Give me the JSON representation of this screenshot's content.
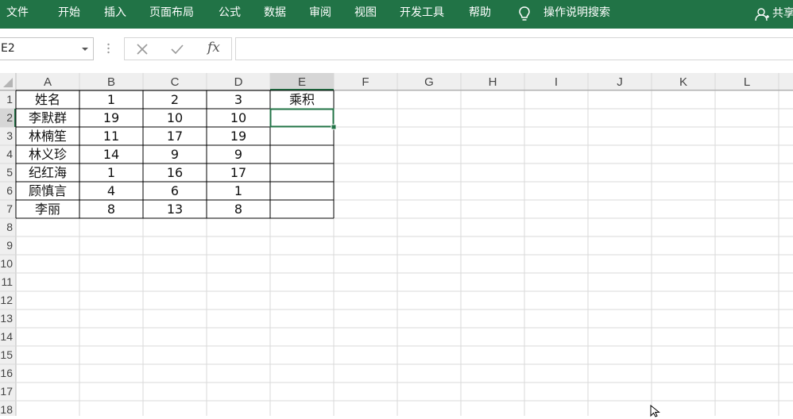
{
  "ribbon": {
    "tabs": [
      "文件",
      "开始",
      "插入",
      "页面布局",
      "公式",
      "数据",
      "审阅",
      "视图",
      "开发工具",
      "帮助"
    ],
    "tell_me": "操作说明搜索",
    "share": "共享",
    "colors": {
      "ribbon_bg": "#217346",
      "ribbon_text": "#ffffff"
    }
  },
  "formula_bar": {
    "name_box": "E2",
    "cancel_icon": "x-icon",
    "enter_icon": "check-icon",
    "function_label": "fx",
    "formula": ""
  },
  "sheet": {
    "columns": [
      "A",
      "B",
      "C",
      "D",
      "E",
      "F",
      "G",
      "H",
      "I",
      "J",
      "K",
      "L"
    ],
    "rows": [
      "1",
      "2",
      "3",
      "4",
      "5",
      "6",
      "7",
      "8",
      "9",
      "10",
      "11",
      "12",
      "13",
      "14",
      "15",
      "16",
      "17",
      "18"
    ],
    "selected_cell": "E2",
    "table": [
      [
        "姓名",
        "1",
        "2",
        "3",
        "乘积"
      ],
      [
        "李默群",
        "19",
        "10",
        "10",
        ""
      ],
      [
        "林楠笙",
        "11",
        "17",
        "19",
        ""
      ],
      [
        "林义珍",
        "14",
        "9",
        "9",
        ""
      ],
      [
        "纪红海",
        "1",
        "16",
        "17",
        ""
      ],
      [
        "顾慎言",
        "4",
        "6",
        "1",
        ""
      ],
      [
        "李丽",
        "8",
        "13",
        "8",
        ""
      ]
    ]
  }
}
